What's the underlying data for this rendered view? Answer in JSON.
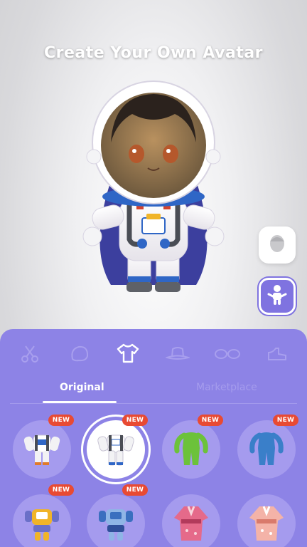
{
  "header": {
    "title": "Create Your Own Avatar"
  },
  "side_buttons": {
    "face": "face-icon",
    "body": "body-icon"
  },
  "categories": [
    "scissors-icon",
    "head-icon",
    "shirt-icon",
    "hat-icon",
    "glasses-icon",
    "shoe-icon"
  ],
  "tabs": {
    "original": "Original",
    "marketplace": "Marketplace"
  },
  "items": [
    {
      "icon": "astronaut-suit-icon",
      "badge": "NEW"
    },
    {
      "icon": "astronaut-suit-icon",
      "badge": "NEW",
      "selected": true
    },
    {
      "icon": "green-bodysuit-icon",
      "badge": "NEW"
    },
    {
      "icon": "blue-bodysuit-icon",
      "badge": "NEW"
    },
    {
      "icon": "robot-suit-icon",
      "badge": "NEW"
    },
    {
      "icon": "robot-suit-icon",
      "badge": "NEW"
    },
    {
      "icon": "kimono-icon"
    },
    {
      "icon": "kimono-icon"
    }
  ],
  "colors": {
    "panel": "#8d83e6",
    "accent": "#7f73e0",
    "badge": "#e84a33"
  }
}
